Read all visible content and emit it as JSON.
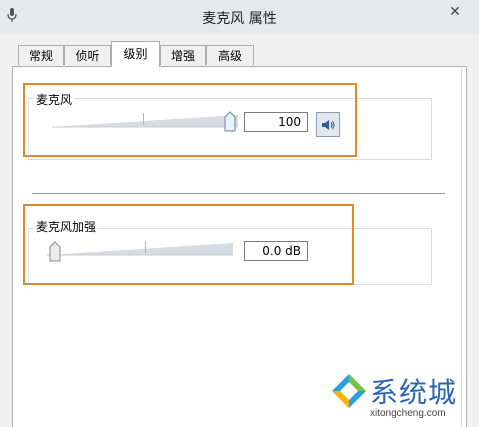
{
  "window": {
    "title": "麦克风 属性",
    "close_glyph": "✕"
  },
  "tabs": [
    {
      "label": "常规",
      "active": false
    },
    {
      "label": "侦听",
      "active": false
    },
    {
      "label": "级别",
      "active": true
    },
    {
      "label": "增强",
      "active": false
    },
    {
      "label": "高级",
      "active": false
    }
  ],
  "level": {
    "microphone": {
      "label": "麦克风",
      "value": "100",
      "slider_fraction": 1.0
    },
    "boost": {
      "label": "麦克风加强",
      "value": "0.0 dB",
      "slider_fraction": 0.0
    }
  },
  "icons": {
    "mute_toggle": "speaker-icon",
    "app": "microphone-icon"
  },
  "colors": {
    "highlight": "#e28a2a",
    "watermark": "#2a64b6"
  },
  "watermark": {
    "brand_cn": "系统城",
    "brand_en": "xitongcheng.com"
  }
}
